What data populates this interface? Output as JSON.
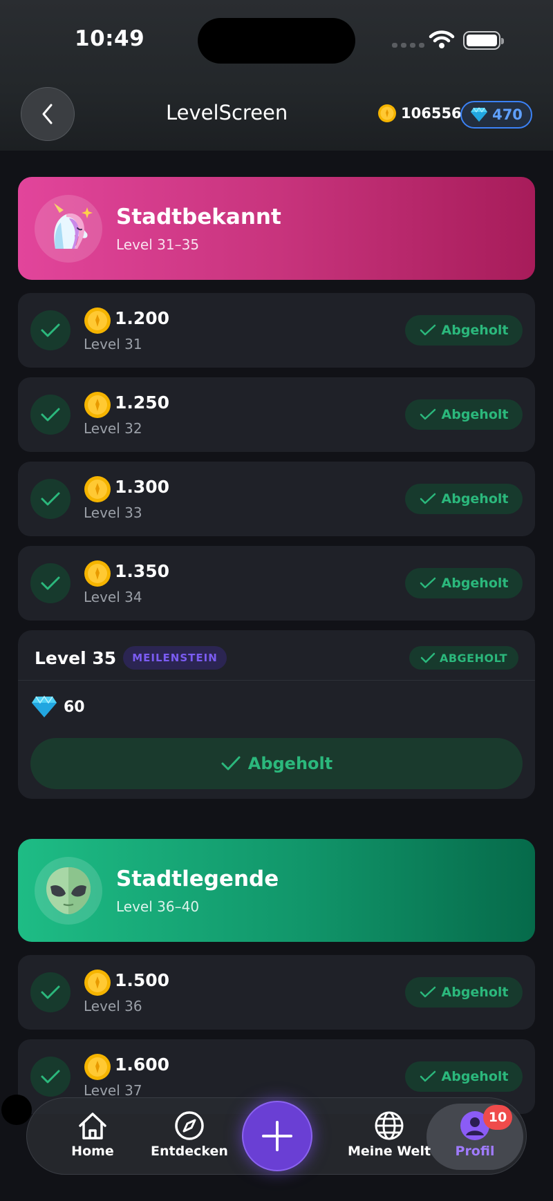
{
  "status_bar": {
    "time": "10:49"
  },
  "header": {
    "title": "LevelScreen",
    "coins": "106556",
    "gems": "470"
  },
  "tiers": [
    {
      "name": "Stadtbekannt",
      "range": "Level 31–35",
      "rewards": [
        {
          "amount": "1.200",
          "level": "Level 31",
          "status": "Abgeholt"
        },
        {
          "amount": "1.250",
          "level": "Level 32",
          "status": "Abgeholt"
        },
        {
          "amount": "1.300",
          "level": "Level 33",
          "status": "Abgeholt"
        },
        {
          "amount": "1.350",
          "level": "Level 34",
          "status": "Abgeholt"
        }
      ],
      "milestone": {
        "level": "Level 35",
        "tag": "MEILENSTEIN",
        "status": "ABGEHOLT",
        "reward_gems": "60",
        "button": "Abgeholt"
      }
    },
    {
      "name": "Stadtlegende",
      "range": "Level 36–40",
      "rewards": [
        {
          "amount": "1.500",
          "level": "Level 36",
          "status": "Abgeholt"
        },
        {
          "amount": "1.600",
          "level": "Level 37",
          "status": "Abgeholt"
        }
      ]
    }
  ],
  "tab_bar": {
    "home": "Home",
    "explore": "Entdecken",
    "world": "Meine Welt",
    "profile": "Profil",
    "profile_badge": "10"
  },
  "colors": {
    "accent_green": "#2bb87c",
    "accent_purple": "#6a3fd4",
    "tier1": "#d63d8a",
    "tier2": "#14a876",
    "gem_blue": "#3b82f6"
  }
}
